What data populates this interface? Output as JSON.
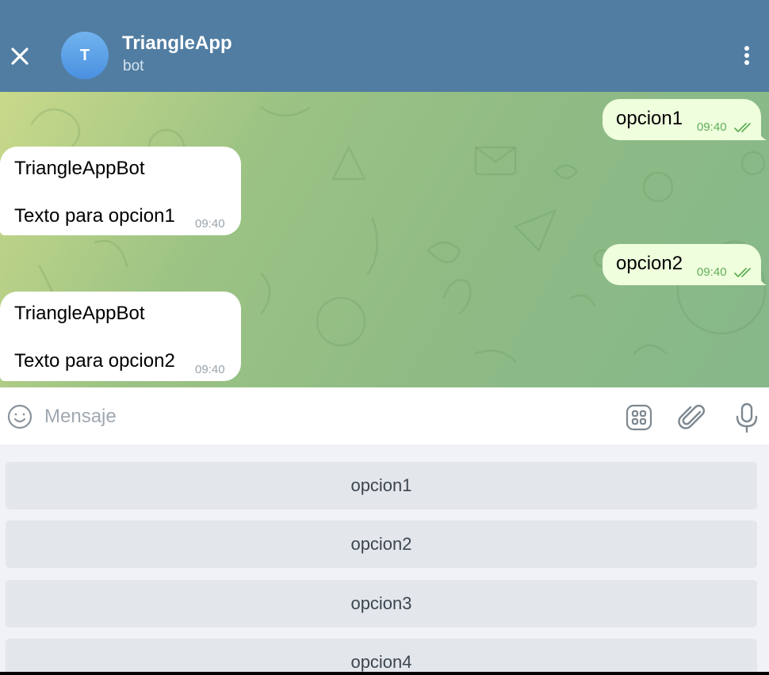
{
  "header": {
    "avatar_letter": "T",
    "title": "TriangleApp",
    "subtitle": "bot",
    "close_icon": "close-icon",
    "menu_icon": "more-vertical-icon"
  },
  "messages": [
    {
      "direction": "outgoing",
      "text": "opcion1",
      "time": "09:40",
      "status": "read"
    },
    {
      "direction": "incoming",
      "sender": "TriangleAppBot",
      "text": "Texto para opcion1",
      "time": "09:40"
    },
    {
      "direction": "outgoing",
      "text": "opcion2",
      "time": "09:40",
      "status": "read"
    },
    {
      "direction": "incoming",
      "sender": "TriangleAppBot",
      "text": "Texto para opcion2",
      "time": "09:40"
    }
  ],
  "input": {
    "placeholder": "Mensaje",
    "value": ""
  },
  "keyboard": {
    "buttons": [
      "opcion1",
      "opcion2",
      "opcion3",
      "opcion4"
    ]
  },
  "colors": {
    "header": "#517da2",
    "outgoing_bubble": "#effedd",
    "incoming_bubble": "#ffffff",
    "read_check": "#5fae58",
    "keyboard_button": "#e3e6ea"
  }
}
